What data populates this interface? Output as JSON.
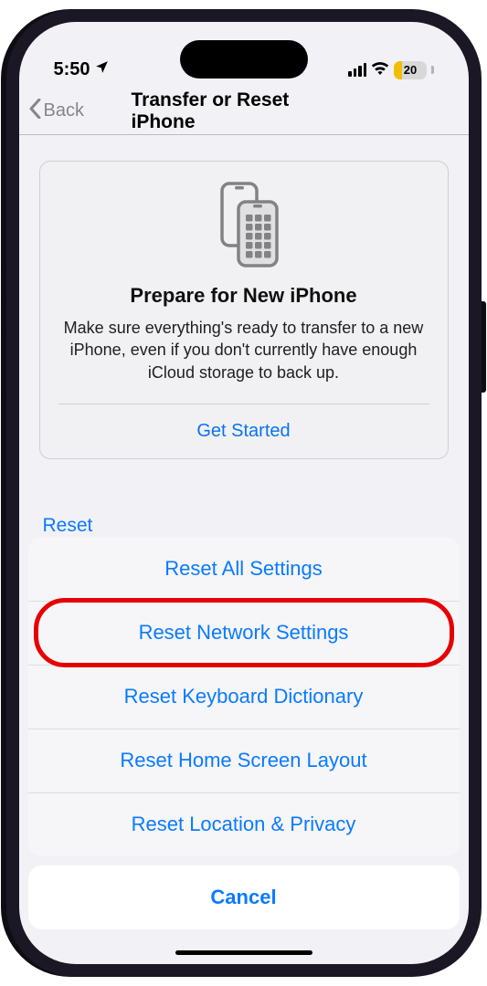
{
  "status_bar": {
    "time": "5:50",
    "battery_percent": "20"
  },
  "nav": {
    "back_label": "Back",
    "title": "Transfer or Reset iPhone"
  },
  "card": {
    "title": "Prepare for New iPhone",
    "text": "Make sure everything's ready to transfer to a new iPhone, even if you don't currently have enough iCloud storage to back up.",
    "cta": "Get Started"
  },
  "underneath_button": "Reset",
  "sheet": {
    "options": [
      "Reset All Settings",
      "Reset Network Settings",
      "Reset Keyboard Dictionary",
      "Reset Home Screen Layout",
      "Reset Location & Privacy"
    ],
    "cancel": "Cancel"
  },
  "highlighted_index": 1,
  "colors": {
    "accent": "#0a7aff",
    "highlight": "#e60000",
    "battery_low": "#ffcc00",
    "bg": "#f2f2f6"
  }
}
